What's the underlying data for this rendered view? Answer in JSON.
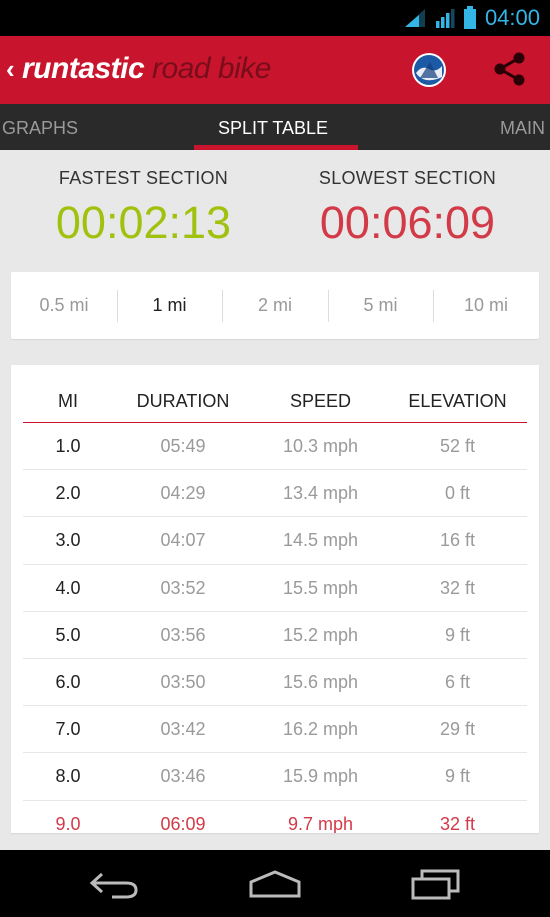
{
  "status": {
    "time": "04:00"
  },
  "app": {
    "brand_main": "runtastic",
    "brand_sub": "road bike"
  },
  "tabs": [
    {
      "label": "GRAPHS",
      "active": false
    },
    {
      "label": "SPLIT TABLE",
      "active": true
    },
    {
      "label": "MAIN",
      "active": false
    }
  ],
  "summary": {
    "fastest_label": "FASTEST SECTION",
    "fastest_value": "00:02:13",
    "slowest_label": "SLOWEST SECTION",
    "slowest_value": "00:06:09"
  },
  "intervals": [
    {
      "label": "0.5 mi",
      "active": false
    },
    {
      "label": "1 mi",
      "active": true
    },
    {
      "label": "2 mi",
      "active": false
    },
    {
      "label": "5 mi",
      "active": false
    },
    {
      "label": "10 mi",
      "active": false
    }
  ],
  "table": {
    "headers": [
      "MI",
      "DURATION",
      "SPEED",
      "ELEVATION"
    ],
    "rows": [
      {
        "mi": "1.0",
        "duration": "05:49",
        "speed": "10.3 mph",
        "elevation": "52 ft"
      },
      {
        "mi": "2.0",
        "duration": "04:29",
        "speed": "13.4 mph",
        "elevation": "0 ft"
      },
      {
        "mi": "3.0",
        "duration": "04:07",
        "speed": "14.5 mph",
        "elevation": "16 ft"
      },
      {
        "mi": "4.0",
        "duration": "03:52",
        "speed": "15.5 mph",
        "elevation": "32 ft"
      },
      {
        "mi": "5.0",
        "duration": "03:56",
        "speed": "15.2 mph",
        "elevation": "9 ft"
      },
      {
        "mi": "6.0",
        "duration": "03:50",
        "speed": "15.6 mph",
        "elevation": "6 ft"
      },
      {
        "mi": "7.0",
        "duration": "03:42",
        "speed": "16.2 mph",
        "elevation": "29 ft"
      },
      {
        "mi": "8.0",
        "duration": "03:46",
        "speed": "15.9 mph",
        "elevation": "9 ft"
      },
      {
        "mi": "9.0",
        "duration": "06:09",
        "speed": "9.7 mph",
        "elevation": "32 ft",
        "highlight": "slowest"
      }
    ]
  },
  "colors": {
    "brand_red": "#c8142c",
    "fastest": "#a0c20f",
    "slowest": "#d23a48",
    "status_accent": "#33b5e5"
  },
  "icons": {
    "status": [
      "wifi-icon",
      "signal-icon",
      "battery-icon"
    ],
    "actionbar": [
      "globe-icon",
      "share-icon"
    ],
    "nav": [
      "back-icon",
      "home-icon",
      "recent-apps-icon"
    ]
  }
}
